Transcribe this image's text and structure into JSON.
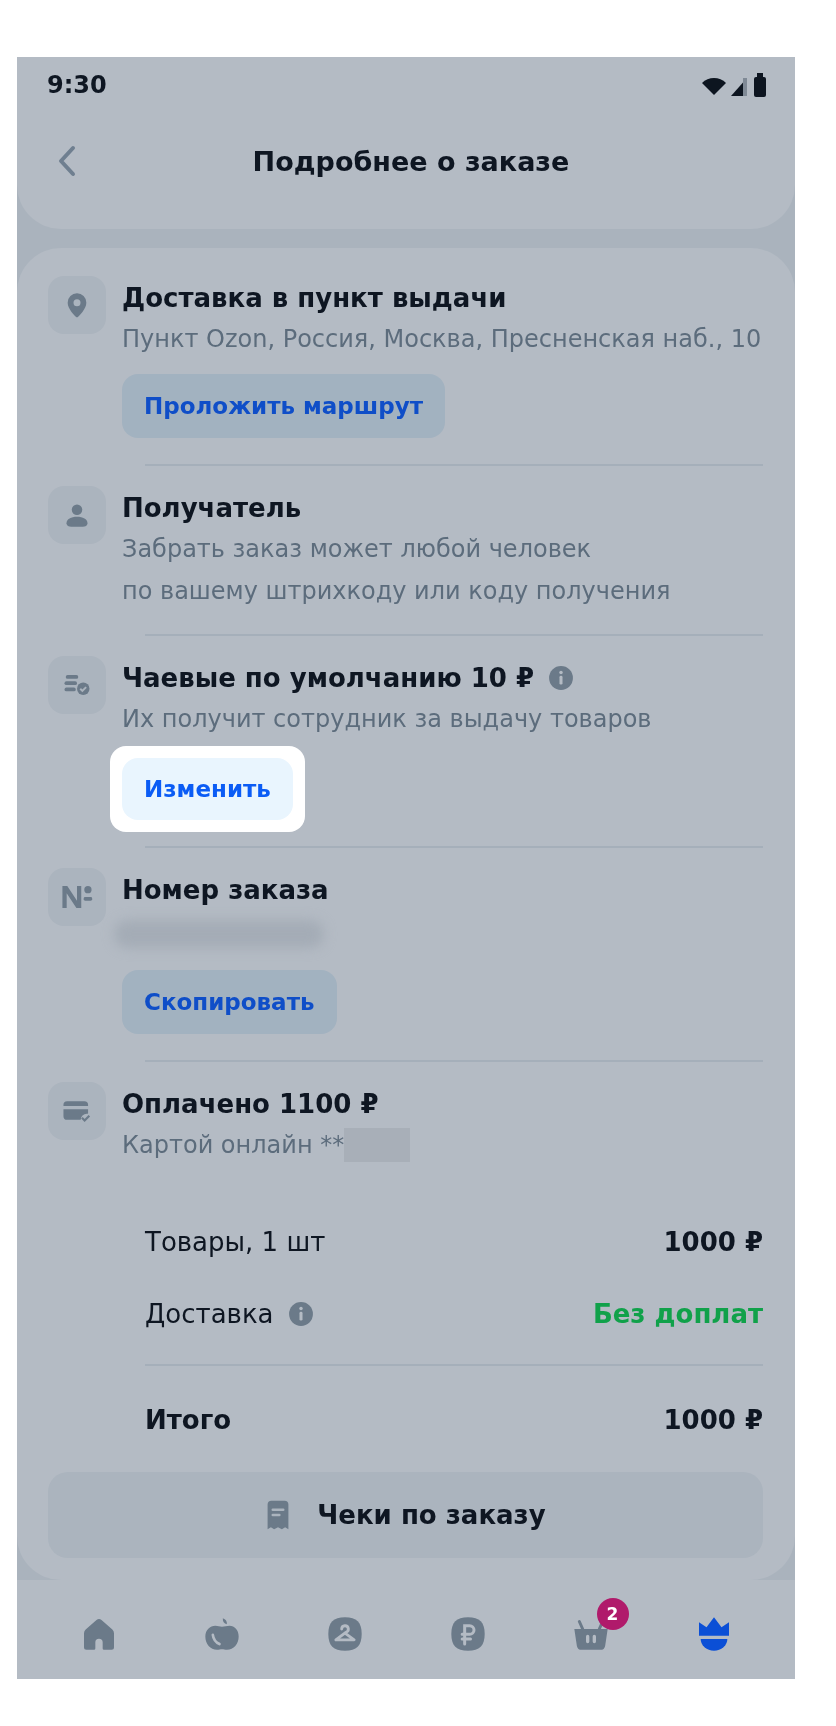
{
  "status_bar": {
    "time": "9:30"
  },
  "header": {
    "title": "Подробнее о заказе"
  },
  "sections": [
    {
      "kind": "pickup",
      "title": "Доставка в пункт выдачи",
      "lines": [
        "Пункт Ozon, Россия, Москва, Пресненская наб., 10"
      ],
      "button": {
        "label": "Проложить маршрут"
      }
    },
    {
      "kind": "recipient",
      "title": "Получатель",
      "lines": [
        "Забрать заказ может любой человек",
        "по вашему штрихкоду или коду получения"
      ]
    },
    {
      "kind": "tips",
      "title": "Чаевые по умолчанию 10 ₽",
      "info": true,
      "lines": [
        "Их получит сотрудник за выдачу товаров"
      ],
      "button": {
        "label": "Изменить",
        "highlighted": true
      }
    },
    {
      "kind": "order",
      "title": "Номер заказа",
      "button": {
        "label": "Скопировать"
      }
    },
    {
      "kind": "payment",
      "title": "Оплачено 1100 ₽",
      "lines": [
        "Картой онлайн **"
      ]
    }
  ],
  "summary": [
    {
      "kind": "line",
      "label": "Товары, 1 шт",
      "value": "1000 ₽"
    },
    {
      "kind": "line",
      "label": "Доставка",
      "value": "Без доплат",
      "info": true,
      "color": "#10a14a"
    },
    {
      "kind": "total",
      "label": "Итого",
      "value": "1000 ₽"
    }
  ],
  "receipts_button": {
    "label": "Чеки по заказу"
  },
  "nav": [
    {
      "kind": "home",
      "selected": false
    },
    {
      "kind": "fresh",
      "selected": false
    },
    {
      "kind": "clothes",
      "selected": false
    },
    {
      "kind": "finance",
      "selected": false
    },
    {
      "kind": "cart",
      "selected": false,
      "badge": "2"
    },
    {
      "kind": "profile",
      "selected": true
    }
  ]
}
